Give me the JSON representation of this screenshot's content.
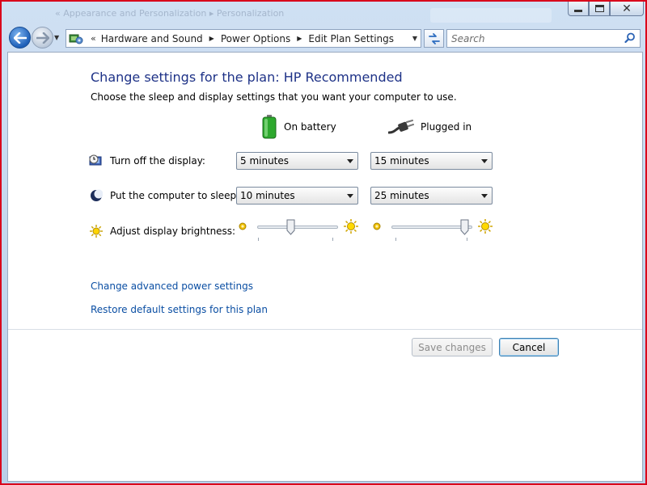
{
  "window": {
    "ghost_title": "«  Appearance and Personalization  ▸  Personalization",
    "controls": {
      "minimize": "minimize",
      "maximize": "maximize",
      "close": "✕"
    }
  },
  "address_bar": {
    "overflow": "«",
    "breadcrumbs": [
      {
        "label": "Hardware and Sound"
      },
      {
        "label": "Power Options"
      },
      {
        "label": "Edit Plan Settings"
      }
    ]
  },
  "search": {
    "placeholder": "Search"
  },
  "page": {
    "title": "Change settings for the plan: HP Recommended",
    "subtitle": "Choose the sleep and display settings that you want your computer to use.",
    "columns": {
      "battery": "On battery",
      "plugged": "Plugged in"
    },
    "settings": {
      "display": {
        "label": "Turn off the display:",
        "battery_value": "5 minutes",
        "plugged_value": "15 minutes"
      },
      "sleep": {
        "label": "Put the computer to sleep:",
        "battery_value": "10 minutes",
        "plugged_value": "25 minutes"
      },
      "brightness": {
        "label": "Adjust display brightness:",
        "battery_level": 0.4,
        "plugged_level": 0.95
      }
    },
    "links": {
      "advanced": "Change advanced power settings",
      "restore": "Restore default settings for this plan"
    },
    "buttons": {
      "save": "Save changes",
      "cancel": "Cancel"
    }
  },
  "colors": {
    "heading": "#1e3287",
    "link": "#0a4ea3",
    "window_border": "#d9001b"
  }
}
